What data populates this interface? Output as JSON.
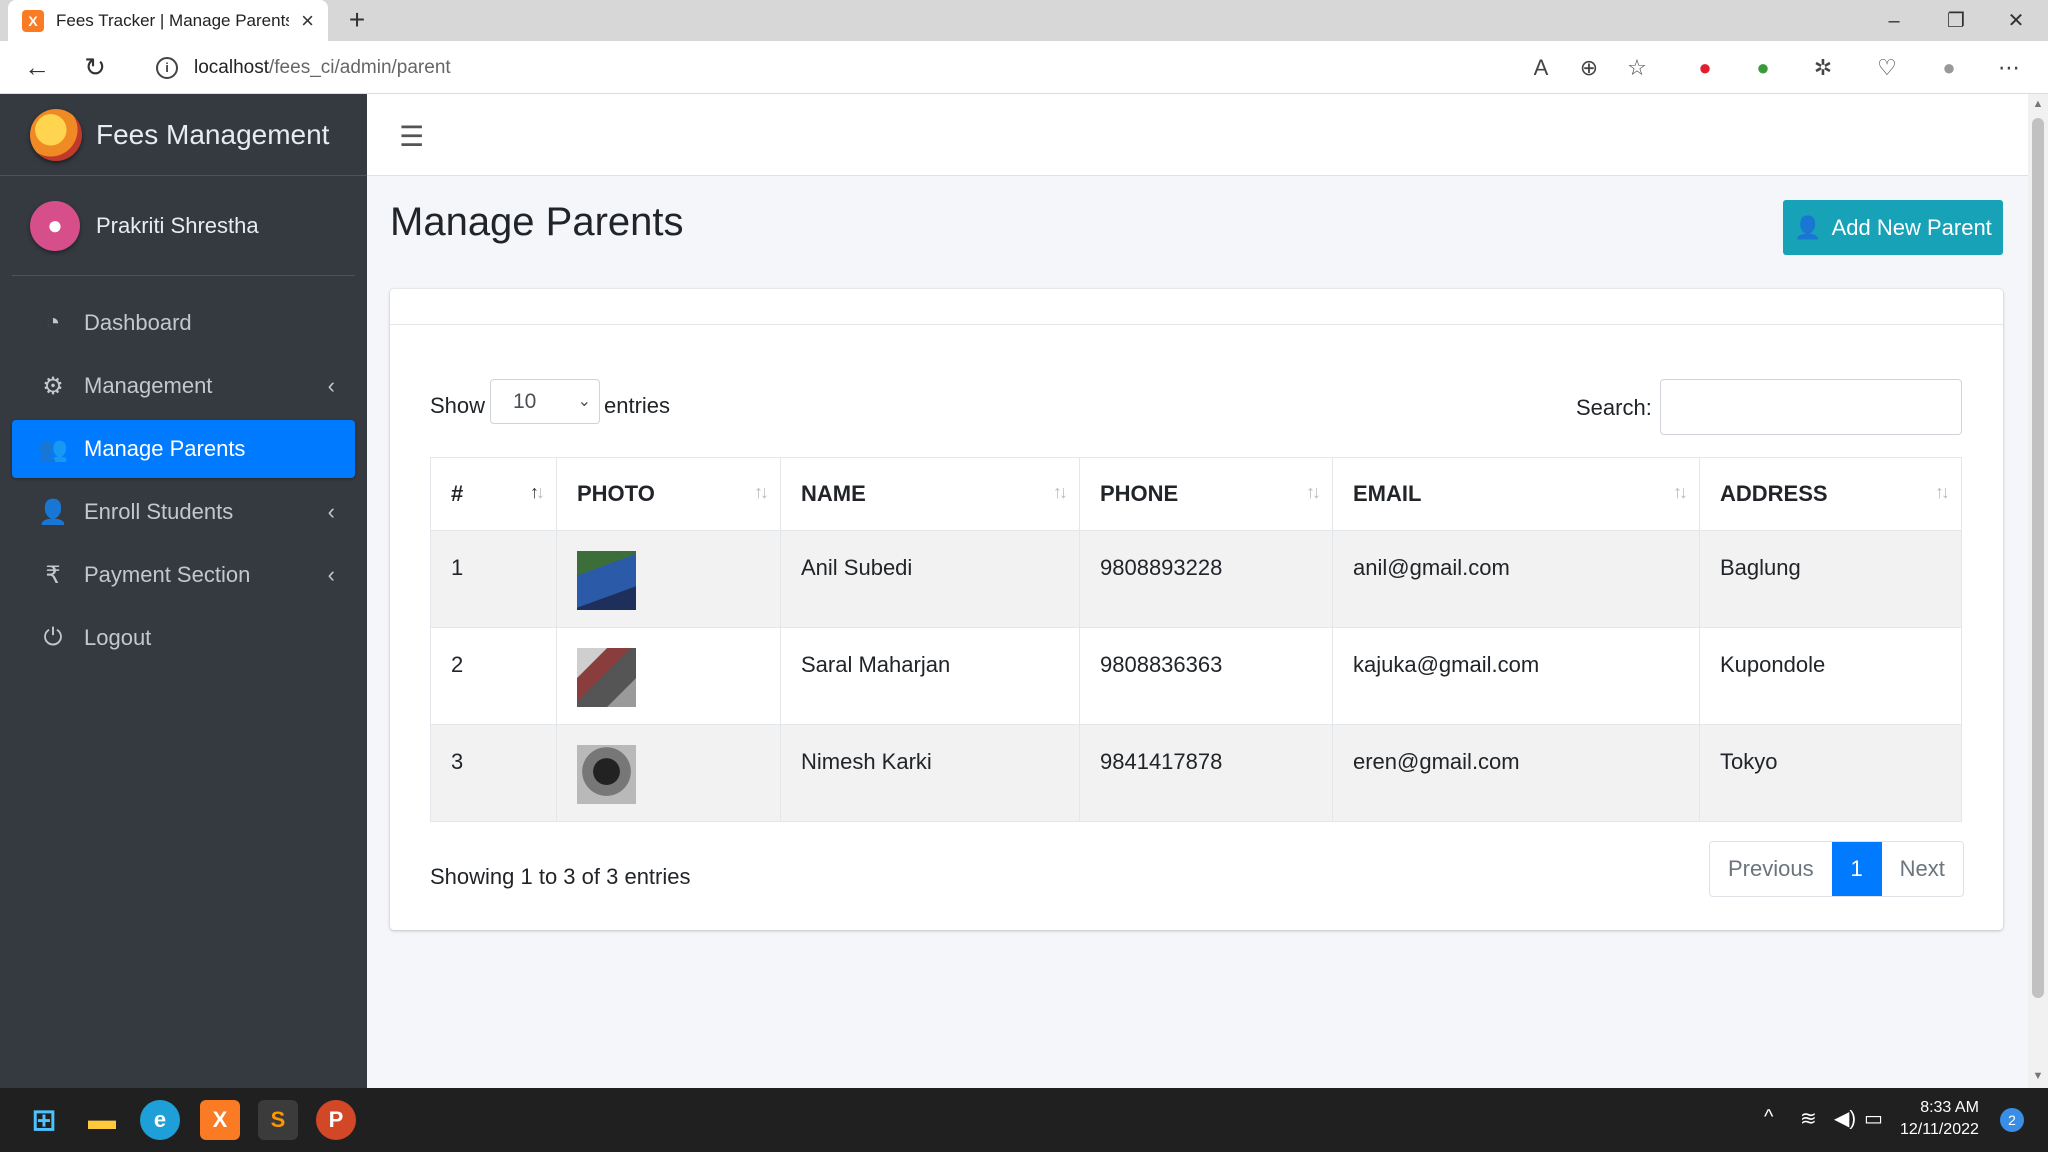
{
  "browser": {
    "tab_title": "Fees Tracker | Manage Parents",
    "url_host": "localhost",
    "url_path": "/fees_ci/admin/parent",
    "favicon_letter": "X"
  },
  "sidebar": {
    "brand": "Fees Management",
    "user_name": "Prakriti Shrestha",
    "items": [
      {
        "label": "Dashboard",
        "icon": "tachometer-icon",
        "active": false,
        "has_chevron": false
      },
      {
        "label": "Management",
        "icon": "cogs-icon",
        "active": false,
        "has_chevron": true
      },
      {
        "label": "Manage Parents",
        "icon": "users-icon",
        "active": true,
        "has_chevron": false
      },
      {
        "label": "Enroll Students",
        "icon": "user-plus-icon",
        "active": false,
        "has_chevron": true
      },
      {
        "label": "Payment Section",
        "icon": "rupee-icon",
        "active": false,
        "has_chevron": true
      },
      {
        "label": "Logout",
        "icon": "power-icon",
        "active": false,
        "has_chevron": false
      }
    ]
  },
  "page": {
    "title": "Manage Parents",
    "add_button": "Add New Parent"
  },
  "datatable": {
    "show_label": "Show",
    "page_length": "10",
    "entries_label": "entries",
    "search_label": "Search:",
    "search_value": "",
    "columns": [
      "#",
      "PHOTO",
      "NAME",
      "PHONE",
      "EMAIL",
      "ADDRESS"
    ],
    "rows": [
      {
        "num": "1",
        "name": "Anil Subedi",
        "phone": "9808893228",
        "email": "anil@gmail.com",
        "address": "Baglung"
      },
      {
        "num": "2",
        "name": "Saral Maharjan",
        "phone": "9808836363",
        "email": "kajuka@gmail.com",
        "address": "Kupondole"
      },
      {
        "num": "3",
        "name": "Nimesh Karki",
        "phone": "9841417878",
        "email": "eren@gmail.com",
        "address": "Tokyo"
      }
    ],
    "info": "Showing 1 to 3 of 3 entries",
    "pagination": {
      "previous": "Previous",
      "current": "1",
      "next": "Next"
    }
  },
  "taskbar": {
    "time": "8:33 AM",
    "date": "12/11/2022",
    "notifications": "2"
  },
  "colors": {
    "sidebar_bg": "#343a40",
    "active_item": "#007bff",
    "add_button": "#17a2b8"
  }
}
